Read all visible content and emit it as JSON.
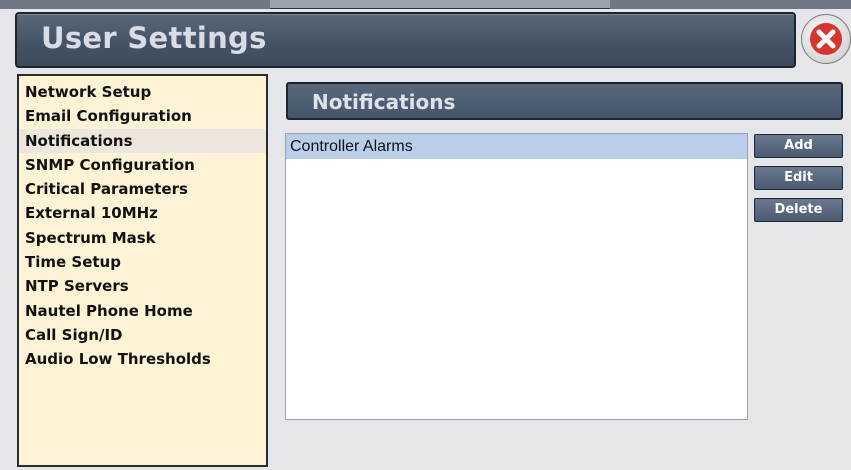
{
  "window": {
    "title": "User Settings",
    "close_icon": "close-x-icon"
  },
  "sidebar": {
    "items": [
      {
        "label": "Network Setup",
        "active": false
      },
      {
        "label": "Email Configuration",
        "active": false
      },
      {
        "label": "Notifications",
        "active": true
      },
      {
        "label": "SNMP Configuration",
        "active": false
      },
      {
        "label": "Critical Parameters",
        "active": false
      },
      {
        "label": "External 10MHz",
        "active": false
      },
      {
        "label": "Spectrum Mask",
        "active": false
      },
      {
        "label": "Time Setup",
        "active": false
      },
      {
        "label": "NTP Servers",
        "active": false
      },
      {
        "label": "Nautel Phone Home",
        "active": false
      },
      {
        "label": "Call Sign/ID",
        "active": false
      },
      {
        "label": "Audio Low Thresholds",
        "active": false
      }
    ]
  },
  "main": {
    "section_title": "Notifications",
    "list": [
      {
        "label": "Controller Alarms",
        "selected": true
      }
    ],
    "actions": {
      "add_label": "Add",
      "edit_label": "Edit",
      "delete_label": "Delete"
    }
  },
  "colors": {
    "title_bar": "#485769",
    "sidebar_bg": "#fef3d5",
    "selected_row": "#b9cfe9",
    "close_red": "#e53935"
  }
}
